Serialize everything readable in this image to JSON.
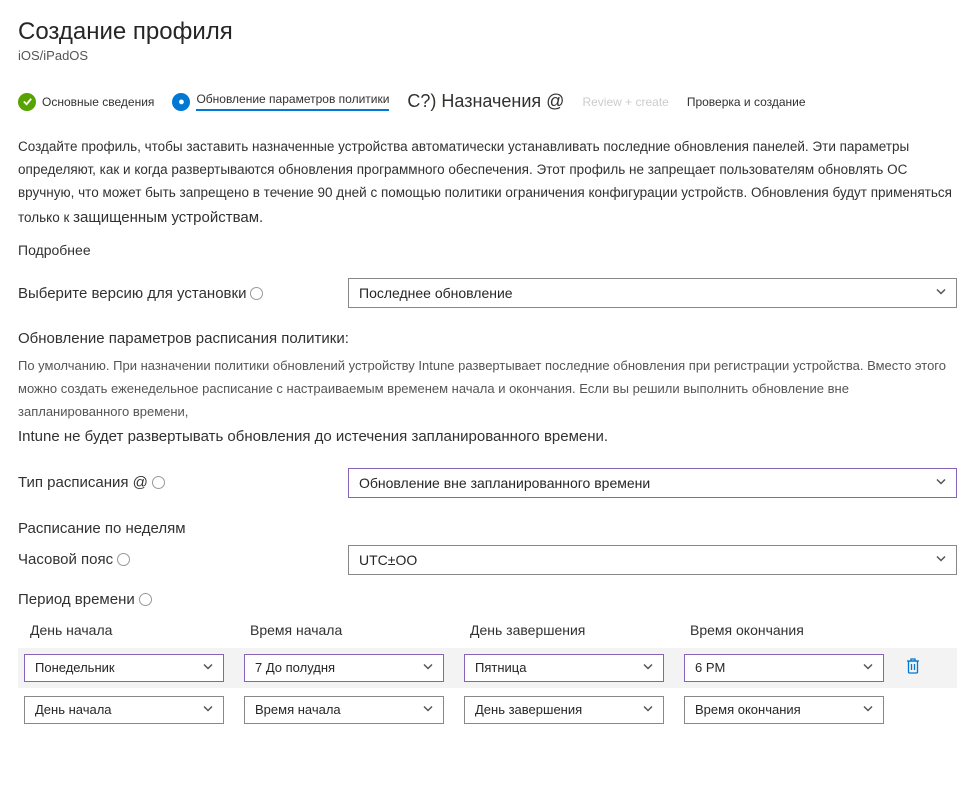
{
  "header": {
    "title": "Создание профиля",
    "subtitle": "iOS/iPadOS"
  },
  "stepper": {
    "step1": "Основные сведения",
    "step2": "Обновление параметров политики",
    "step3": "С?) Назначения @",
    "step4_dim": "Review + create",
    "step4": "Проверка и создание"
  },
  "description": {
    "text": "Создайте профиль, чтобы заставить назначенные устройства автоматически устанавливать последние обновления панелей. Эти параметры определяют, как и когда развертываются обновления программного обеспечения. Этот профиль не запрещает пользователям обновлять ОС вручную, что может быть запрещено в течение 90 дней с помощью политики ограничения конфигурации устройств. Обновления будут применяться только к",
    "strong_end": "защищенным устройствам."
  },
  "learn_more": "Подробнее",
  "version": {
    "label": "Выберите версию для установки",
    "value": "Последнее обновление"
  },
  "schedule_section": {
    "heading": "Обновление параметров расписания политики:",
    "text": "По умолчанию. При назначении политики обновлений устройству Intune развертывает последние обновления при регистрации устройства. Вместо этого можно создать еженедельное расписание с настраиваемым временем начала и окончания. Если вы решили выполнить обновление вне запланированного времени,",
    "strong_end": "Intune не будет развертывать обновления до истечения запланированного времени."
  },
  "schedule_type": {
    "label": "Тип расписания @",
    "value": "Обновление вне запланированного времени"
  },
  "weekly_label": "Расписание по неделям",
  "timezone": {
    "label": "Часовой пояс",
    "value": "UTC±OO"
  },
  "period_label": "Период времени",
  "table": {
    "headers": {
      "start_day": "День начала",
      "start_time": "Время начала",
      "end_day": "День завершения",
      "end_time": "Время окончания"
    },
    "row1": {
      "start_day": "Понедельник",
      "start_time": "7 До полудня",
      "end_day": "Пятница",
      "end_time": "6 PM"
    },
    "row2": {
      "start_day": "День начала",
      "start_time": "Время начала",
      "end_day": "День завершения",
      "end_time": "Время окончания"
    }
  }
}
